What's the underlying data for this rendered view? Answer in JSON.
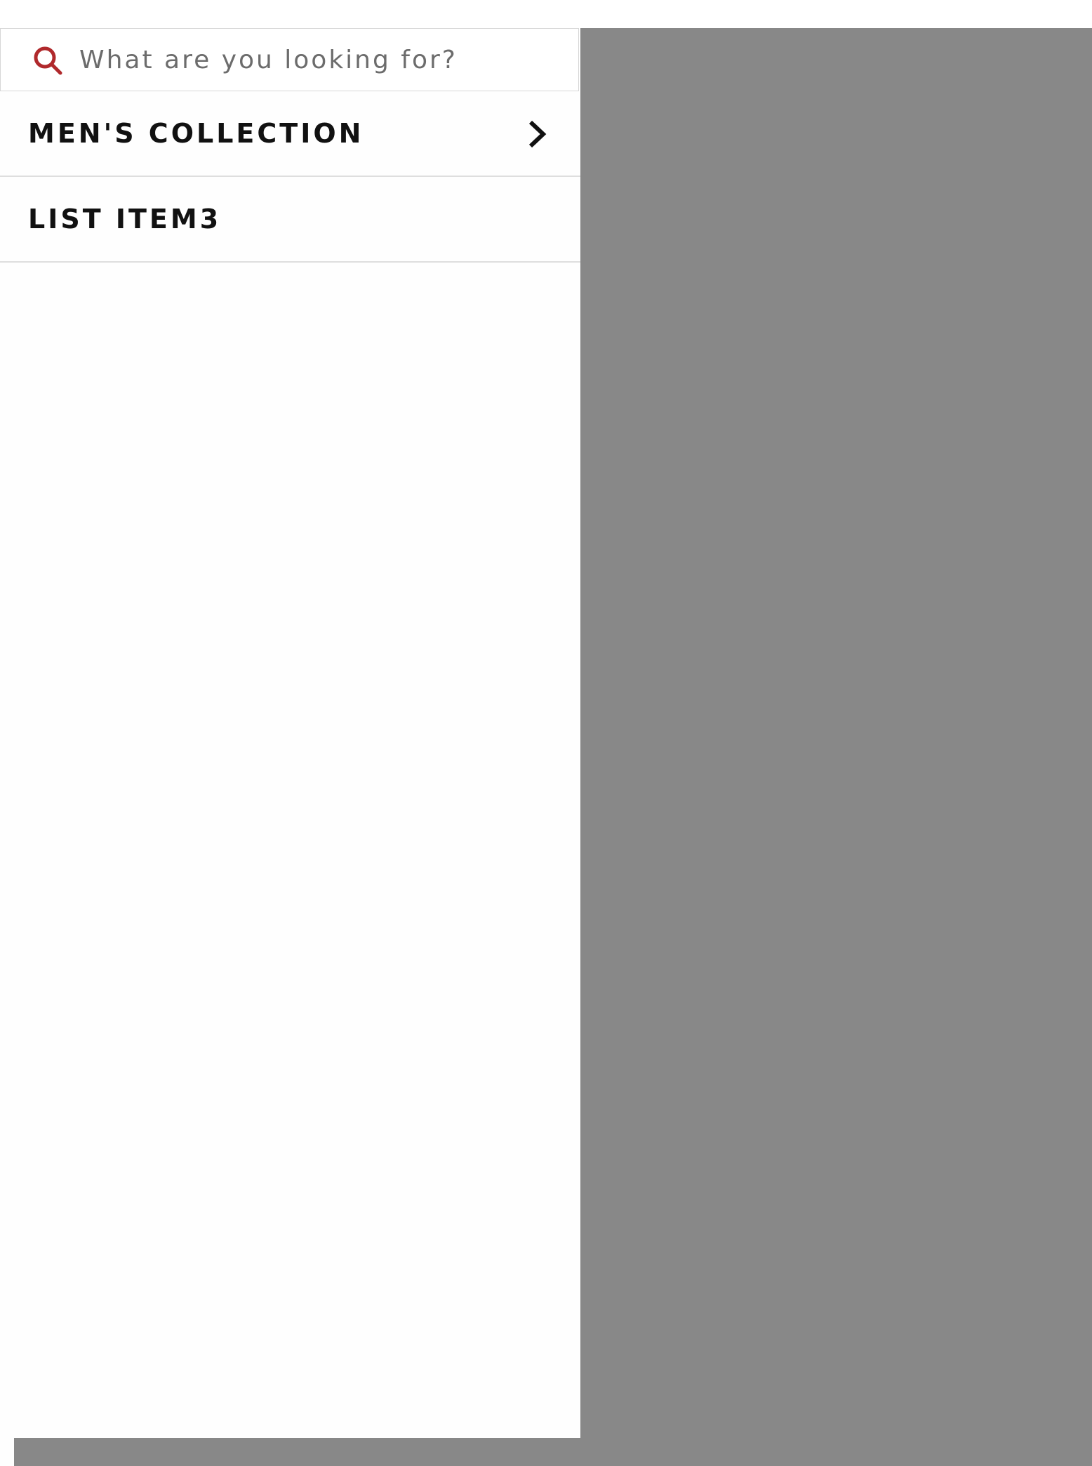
{
  "search": {
    "placeholder": "What are you looking for?",
    "value": "",
    "icon": "search-icon"
  },
  "menu": {
    "items": [
      {
        "label": "MEN'S COLLECTION",
        "icon": "chevron-right-icon"
      },
      {
        "label": "LIST ITEM3"
      }
    ]
  },
  "colors": {
    "overlay": "#888888",
    "drawer_background": "#fefefe",
    "search_icon": "#b0292c",
    "text": "#111111",
    "divider": "#dedede"
  }
}
